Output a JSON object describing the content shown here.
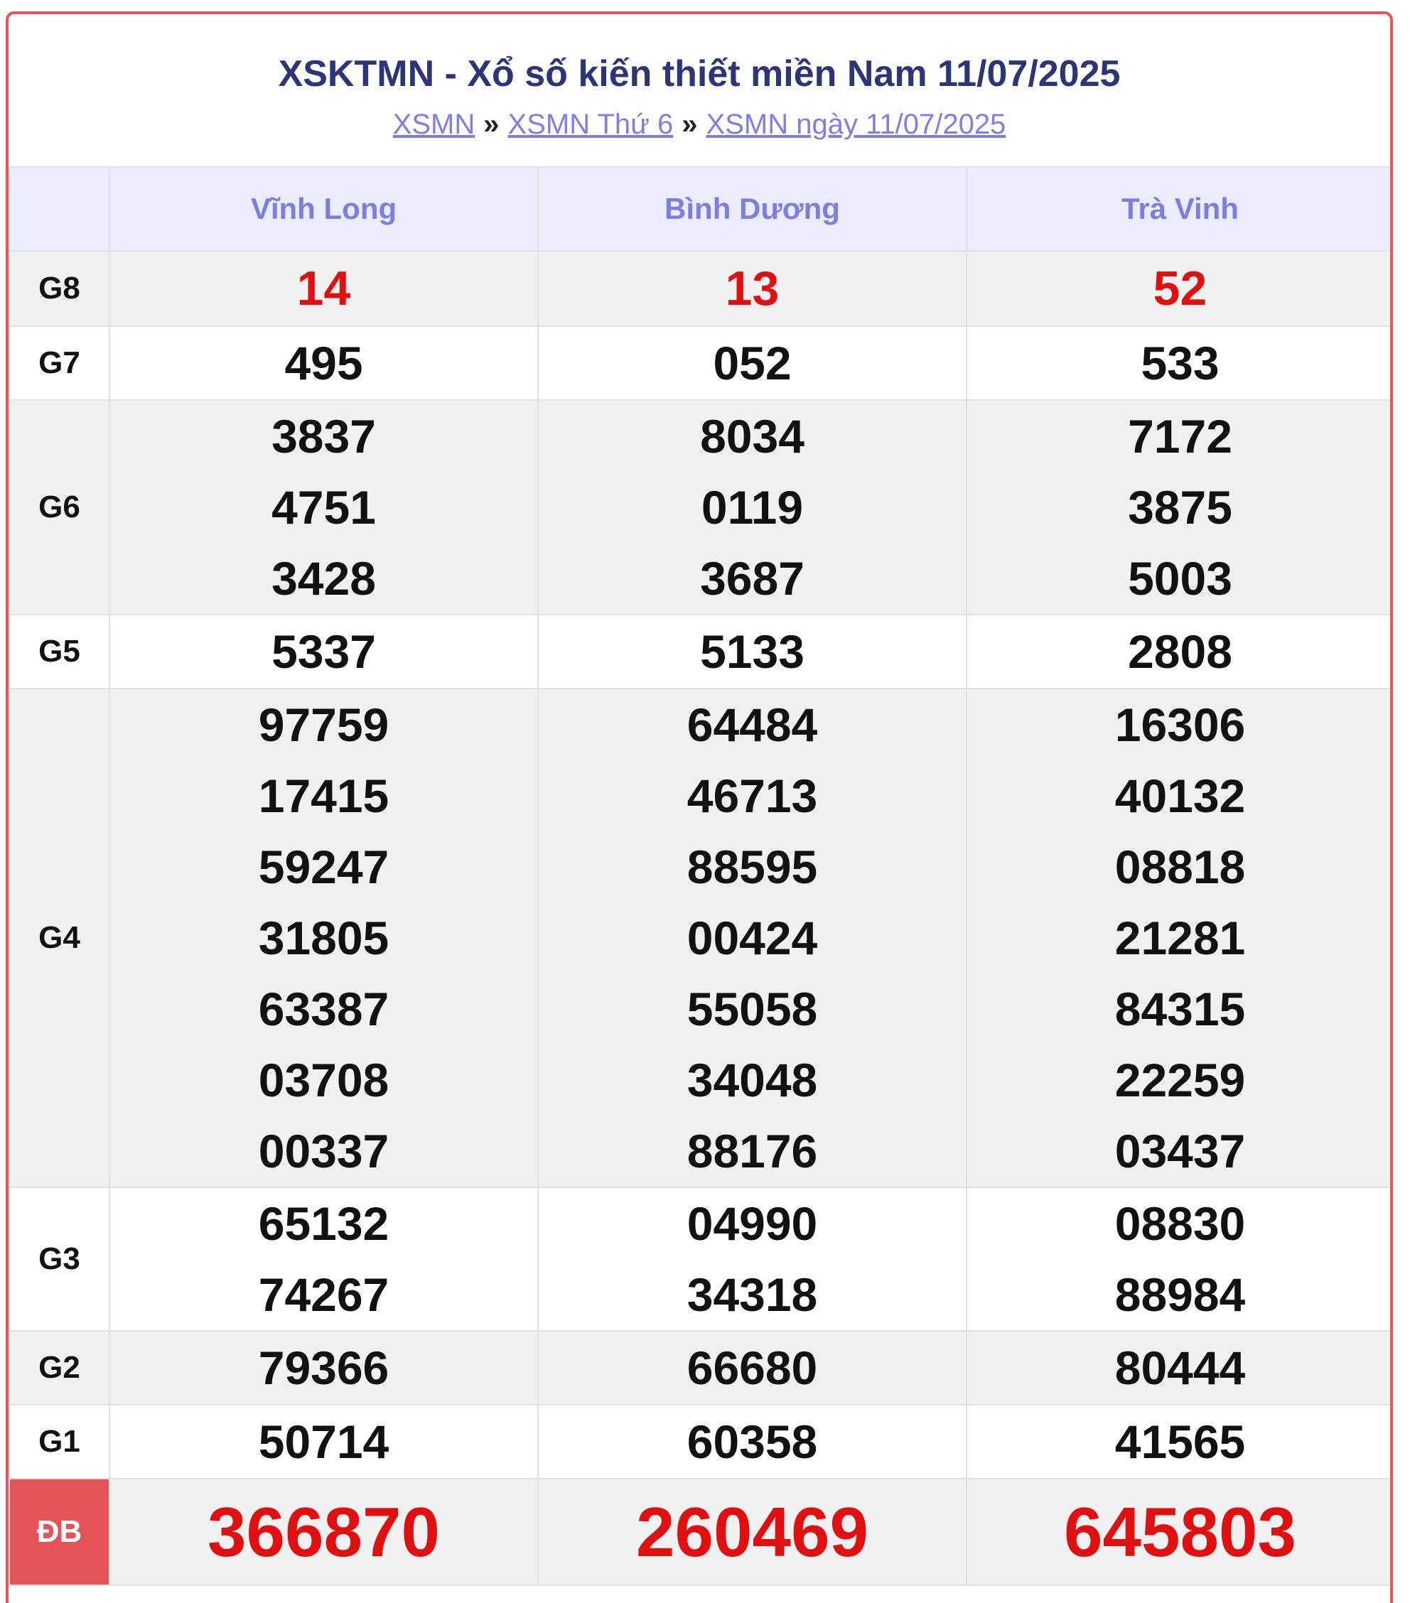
{
  "header": {
    "title": "XSKTMN - Xổ số kiến thiết miền Nam 11/07/2025",
    "breadcrumb": [
      "XSMN",
      "XSMN Thứ 6",
      "XSMN ngày 11/07/2025"
    ],
    "separator": "»"
  },
  "columns": [
    "Vĩnh Long",
    "Bình Dương",
    "Trà Vinh"
  ],
  "prizes": [
    {
      "label": "G8",
      "values": [
        [
          "14"
        ],
        [
          "13"
        ],
        [
          "52"
        ]
      ]
    },
    {
      "label": "G7",
      "values": [
        [
          "495"
        ],
        [
          "052"
        ],
        [
          "533"
        ]
      ]
    },
    {
      "label": "G6",
      "values": [
        [
          "3837",
          "4751",
          "3428"
        ],
        [
          "8034",
          "0119",
          "3687"
        ],
        [
          "7172",
          "3875",
          "5003"
        ]
      ]
    },
    {
      "label": "G5",
      "values": [
        [
          "5337"
        ],
        [
          "5133"
        ],
        [
          "2808"
        ]
      ]
    },
    {
      "label": "G4",
      "values": [
        [
          "97759",
          "17415",
          "59247",
          "31805",
          "63387",
          "03708",
          "00337"
        ],
        [
          "64484",
          "46713",
          "88595",
          "00424",
          "55058",
          "34048",
          "88176"
        ],
        [
          "16306",
          "40132",
          "08818",
          "21281",
          "84315",
          "22259",
          "03437"
        ]
      ]
    },
    {
      "label": "G3",
      "values": [
        [
          "65132",
          "74267"
        ],
        [
          "04990",
          "34318"
        ],
        [
          "08830",
          "88984"
        ]
      ]
    },
    {
      "label": "G2",
      "values": [
        [
          "79366"
        ],
        [
          "66680"
        ],
        [
          "80444"
        ]
      ]
    },
    {
      "label": "G1",
      "values": [
        [
          "50714"
        ],
        [
          "60358"
        ],
        [
          "41565"
        ]
      ]
    },
    {
      "label": "ĐB",
      "values": [
        [
          "366870"
        ],
        [
          "260469"
        ],
        [
          "645803"
        ]
      ]
    }
  ],
  "colors": {
    "border": "#e8555a",
    "title": "#2b3578",
    "link": "#7d7fe6",
    "header_bg": "#ececff",
    "highlight": "#e11010",
    "special_label_bg": "#e45456"
  }
}
